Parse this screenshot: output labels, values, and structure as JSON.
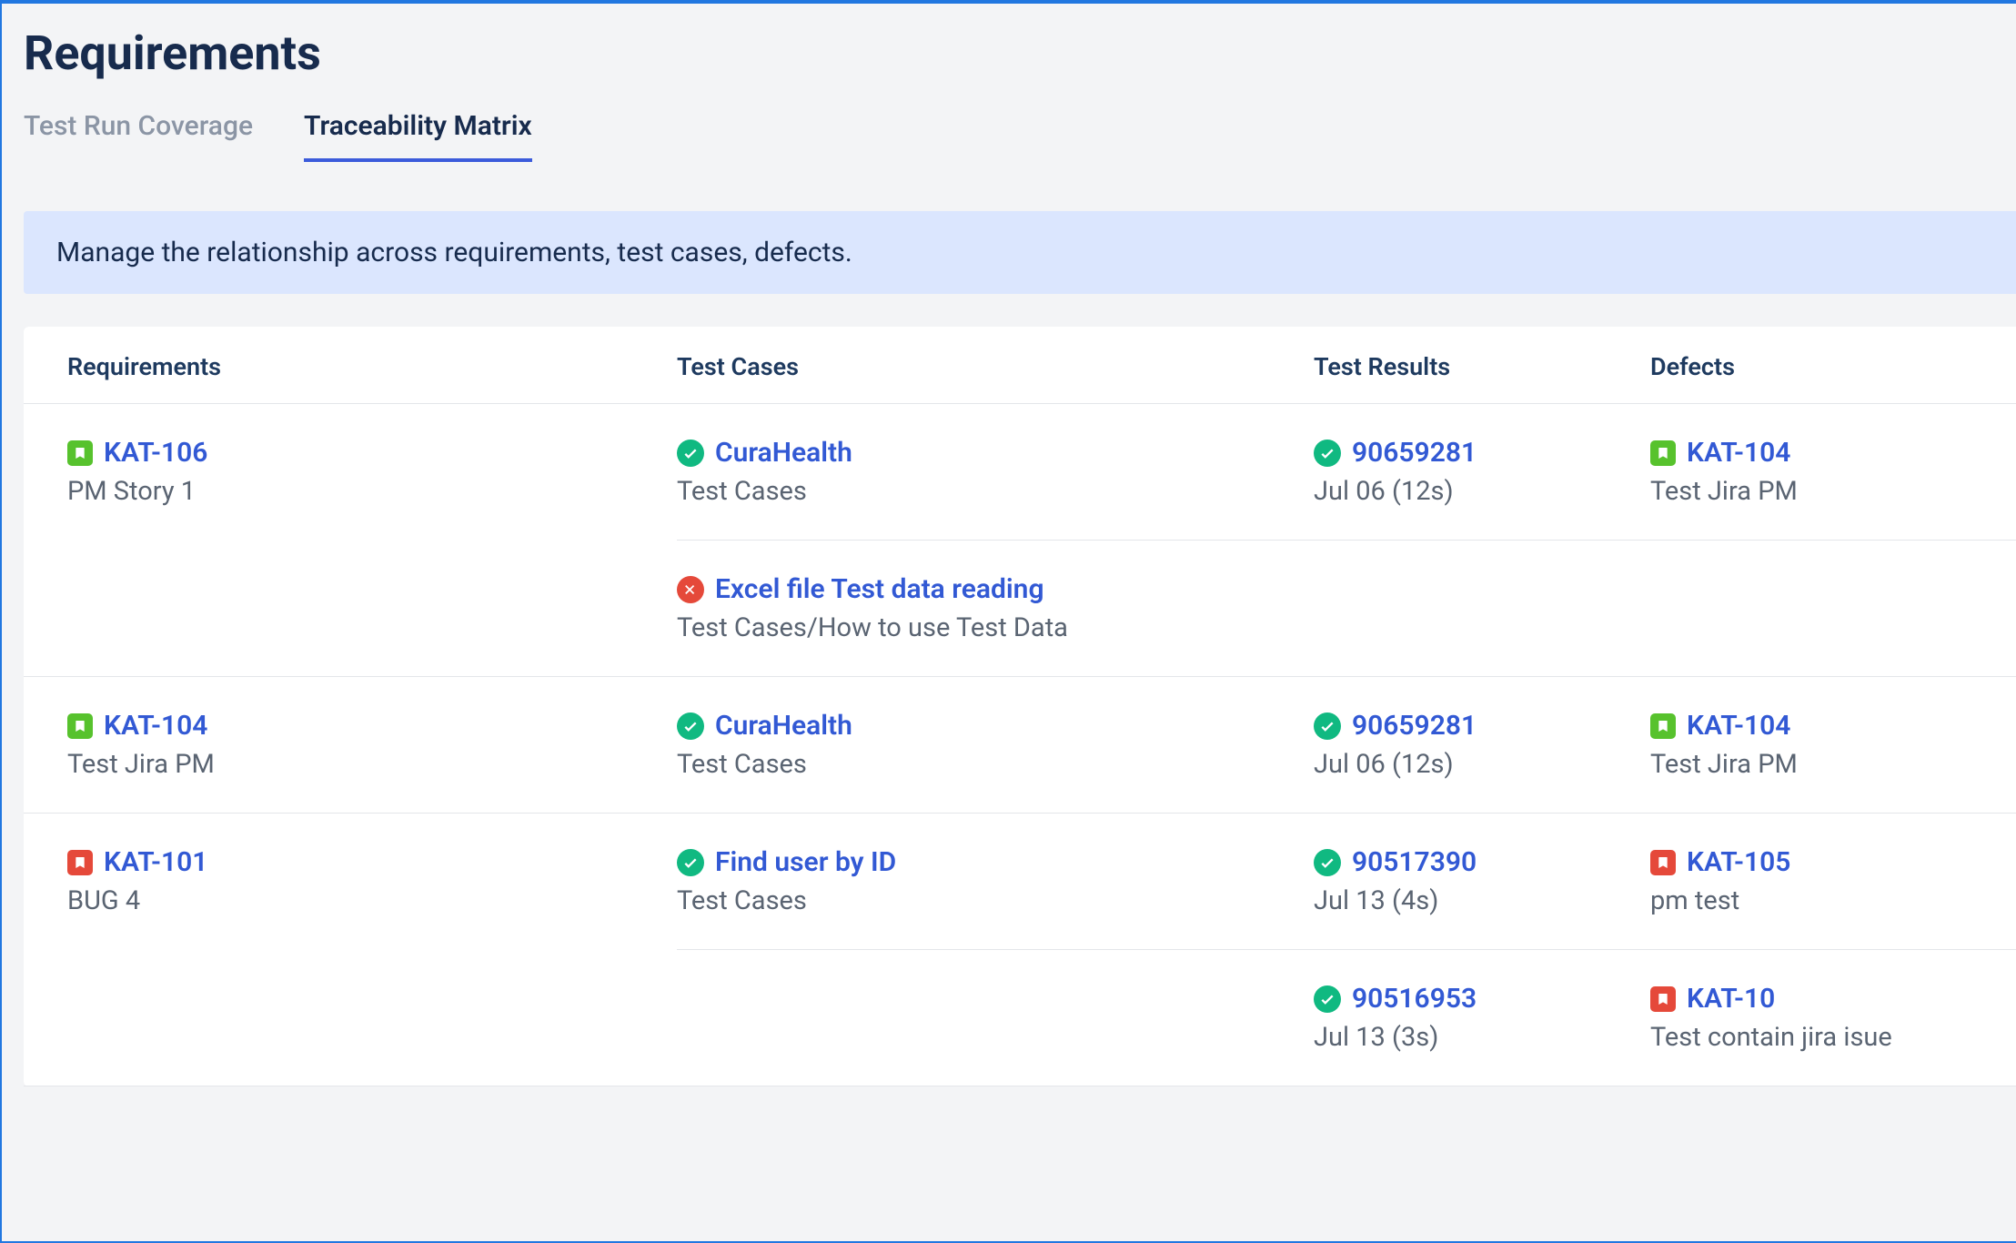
{
  "page_title": "Requirements",
  "tabs": {
    "coverage": "Test Run Coverage",
    "traceability": "Traceability Matrix"
  },
  "banner": "Manage the relationship across requirements, test cases, defects.",
  "columns": {
    "requirements": "Requirements",
    "test_cases": "Test Cases",
    "test_results": "Test Results",
    "defects": "Defects"
  },
  "rows": [
    {
      "req": {
        "icon": "green",
        "id": "KAT-106",
        "desc": "PM Story 1"
      },
      "items": [
        {
          "tc": {
            "status": "pass",
            "name": "CuraHealth",
            "sub": "Test Cases"
          },
          "res": {
            "status": "pass",
            "id": "90659281",
            "sub": "Jul 06 (12s)"
          },
          "def": {
            "icon": "green",
            "id": "KAT-104",
            "desc": "Test Jira PM"
          }
        },
        {
          "tc": {
            "status": "fail",
            "name": "Excel file Test data reading",
            "sub": "Test Cases/How to use Test Data"
          },
          "res": null,
          "def": null
        }
      ]
    },
    {
      "req": {
        "icon": "green",
        "id": "KAT-104",
        "desc": "Test Jira PM"
      },
      "items": [
        {
          "tc": {
            "status": "pass",
            "name": "CuraHealth",
            "sub": "Test Cases"
          },
          "res": {
            "status": "pass",
            "id": "90659281",
            "sub": "Jul 06 (12s)"
          },
          "def": {
            "icon": "green",
            "id": "KAT-104",
            "desc": "Test Jira PM"
          }
        }
      ]
    },
    {
      "req": {
        "icon": "red",
        "id": "KAT-101",
        "desc": "BUG 4"
      },
      "items": [
        {
          "tc": {
            "status": "pass",
            "name": "Find user by ID",
            "sub": "Test Cases"
          },
          "res": {
            "status": "pass",
            "id": "90517390",
            "sub": "Jul 13 (4s)"
          },
          "def": {
            "icon": "red",
            "id": "KAT-105",
            "desc": "pm test"
          }
        },
        {
          "tc": null,
          "res": {
            "status": "pass",
            "id": "90516953",
            "sub": "Jul 13 (3s)"
          },
          "def": {
            "icon": "red",
            "id": "KAT-10",
            "desc": "Test contain jira isue"
          }
        }
      ]
    }
  ]
}
